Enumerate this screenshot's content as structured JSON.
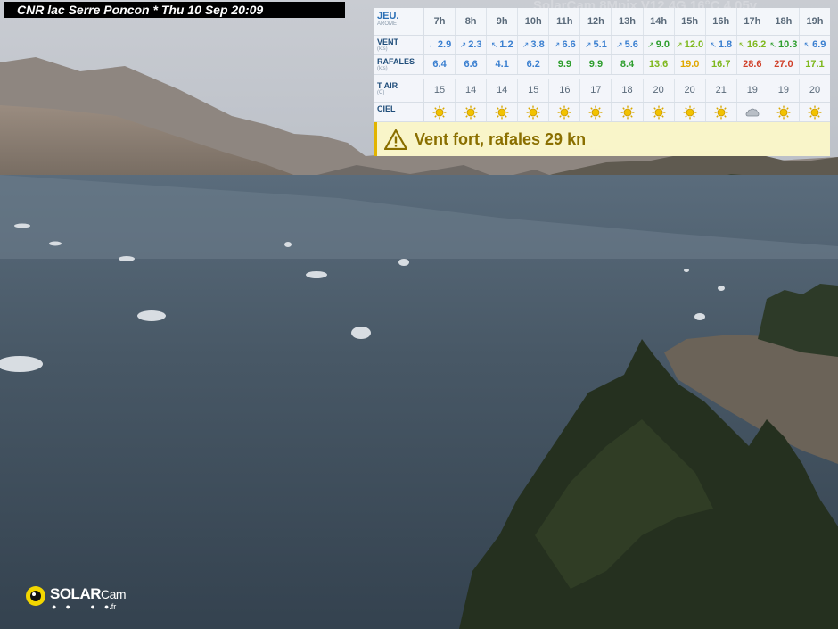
{
  "overlay": {
    "caption": "CNR lac Serre Poncon * Thu 10 Sep 20:09",
    "ghost_text": "SolarCam 8Mpix V12.4G 16°C 4.05v"
  },
  "forecast": {
    "day_label": "JEU.",
    "model": "AROME",
    "hours": [
      "7h",
      "8h",
      "9h",
      "10h",
      "11h",
      "12h",
      "13h",
      "14h",
      "15h",
      "16h",
      "17h",
      "18h",
      "19h"
    ],
    "vent_label": "VENT",
    "vent_unit": "(kts)",
    "vent": [
      "2.9",
      "2.3",
      "1.2",
      "3.8",
      "6.6",
      "5.1",
      "5.6",
      "9.0",
      "12.0",
      "1.8",
      "16.2",
      "10.3",
      "6.9"
    ],
    "vent_arrows": [
      "←",
      "↗",
      "↖",
      "↗",
      "↗",
      "↗",
      "↗",
      "↗",
      "↗",
      "↖",
      "↖",
      "↖",
      "↖"
    ],
    "vent_colors": [
      "#3a7fd0",
      "#3a7fd0",
      "#3a7fd0",
      "#3a7fd0",
      "#3a7fd0",
      "#3a7fd0",
      "#3a7fd0",
      "#2e9e2e",
      "#7fb81e",
      "#3a7fd0",
      "#7fb81e",
      "#2e9e2e",
      "#3a7fd0"
    ],
    "rafales_label": "RAFALES",
    "rafales_unit": "(kts)",
    "rafales": [
      "6.4",
      "6.6",
      "4.1",
      "6.2",
      "9.9",
      "9.9",
      "8.4",
      "13.6",
      "19.0",
      "16.7",
      "28.6",
      "27.0",
      "17.1"
    ],
    "rafales_colors": [
      "#3a7fd0",
      "#3a7fd0",
      "#3a7fd0",
      "#3a7fd0",
      "#2e9e2e",
      "#2e9e2e",
      "#2e9e2e",
      "#7fb81e",
      "#e0a800",
      "#7fb81e",
      "#d0402a",
      "#d0402a",
      "#7fb81e"
    ],
    "tair_label": "T AIR",
    "tair_unit": "(C)",
    "tair": [
      "15",
      "14",
      "14",
      "15",
      "16",
      "17",
      "18",
      "20",
      "20",
      "21",
      "19",
      "19",
      "20"
    ],
    "ciel_label": "CIEL",
    "ciel": [
      "sun-icon",
      "sun-icon",
      "sun-icon",
      "sun-icon",
      "sun-icon",
      "sun-icon",
      "sun-icon",
      "sun-icon",
      "sun-icon",
      "sun-icon",
      "cloud-icon",
      "sun-icon",
      "sun-icon"
    ],
    "alert": "Vent fort, rafales 29 kn"
  },
  "logo": {
    "brand_bold": "SOLAR",
    "brand_light": "Cam",
    "suffix": ".fr"
  }
}
